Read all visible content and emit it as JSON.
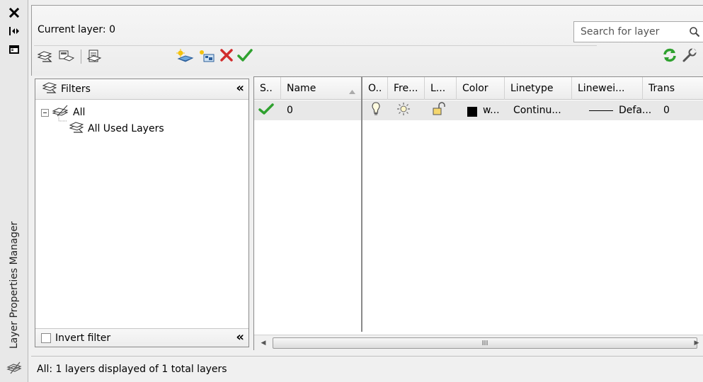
{
  "palette": "Layer Properties Manager",
  "header": {
    "current_layer": "Current layer: 0",
    "search_placeholder": "Search for layer"
  },
  "filters": {
    "title": "Filters",
    "tree": [
      {
        "label": "All",
        "level": 0
      },
      {
        "label": "All Used Layers",
        "level": 1
      }
    ],
    "invert_label": "Invert filter"
  },
  "layers": {
    "columns": [
      "S..",
      "Name",
      "O..",
      "Fre...",
      "L...",
      "Color",
      "Linetype",
      "Linewei...",
      "Trans"
    ],
    "rows": [
      {
        "status": "current",
        "name": "0",
        "on": "bulb",
        "freeze": "sun",
        "lock": "unlocked",
        "color_swatch": "#000000",
        "color": "w...",
        "linetype": "Continu...",
        "lineweight": "Defa...",
        "transparency": "0"
      }
    ],
    "scroll_label": "III"
  },
  "status": "All: 1 layers displayed of 1 total layers",
  "icons": {
    "close": "close-icon",
    "autohide": "autohide-icon",
    "properties": "properties-icon",
    "search": "search-icon",
    "refresh": "refresh-icon",
    "settings": "settings-icon",
    "current_check": "checkmark-icon",
    "delete": "delete-icon"
  },
  "colors": {
    "check_green": "#2fa12f",
    "delete_red": "#d12c2c",
    "row_highlight": "#e8e8e8"
  }
}
